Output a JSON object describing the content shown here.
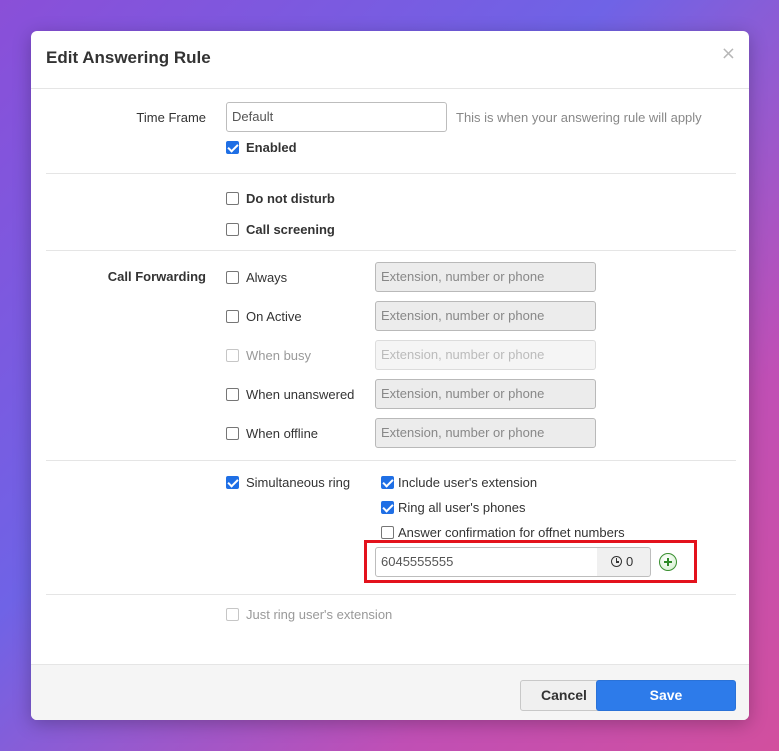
{
  "dialog": {
    "title": "Edit Answering Rule",
    "close": "×"
  },
  "time_frame": {
    "label": "Time Frame",
    "value": "Default",
    "hint": "This is when your answering rule will apply",
    "enabled_label": "Enabled",
    "enabled_checked": true
  },
  "options": {
    "do_not_disturb": "Do not disturb",
    "call_screening": "Call screening"
  },
  "forwarding": {
    "label": "Call Forwarding",
    "placeholder": "Extension, number or phone",
    "rows": [
      {
        "label": "Always",
        "disabled": false
      },
      {
        "label": "On Active",
        "disabled": false
      },
      {
        "label": "When busy",
        "disabled": true
      },
      {
        "label": "When unanswered",
        "disabled": false
      },
      {
        "label": "When offline",
        "disabled": false
      }
    ]
  },
  "simultaneous": {
    "label": "Simultaneous ring",
    "checked": true,
    "include_ext": "Include user's extension",
    "ring_all": "Ring all user's phones",
    "answer_confirm": "Answer confirmation for offnet numbers",
    "number_value": "6045555555",
    "delay_value": "0"
  },
  "just_ring": "Just ring user's extension",
  "footer": {
    "cancel_label": "Cancel",
    "save_label": "Save"
  },
  "colors": {
    "accent": "#2d7bea",
    "highlight": "#e3121c",
    "plus": "#3a8f31"
  }
}
